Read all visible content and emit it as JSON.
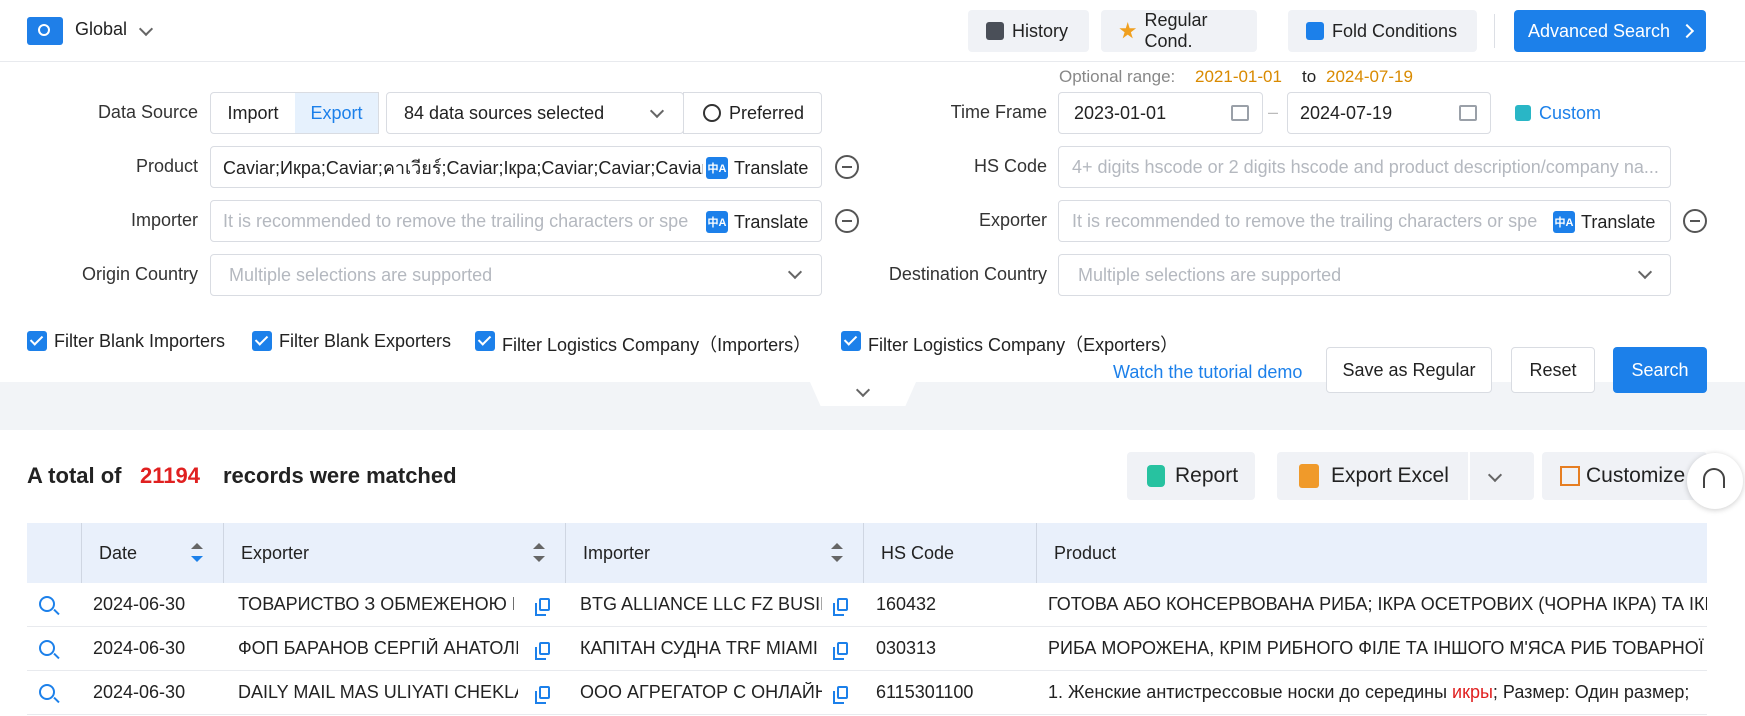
{
  "header": {
    "scope_label": "Global",
    "history": "History",
    "regular_cond": "Regular Cond.",
    "fold_conditions": "Fold Conditions",
    "advanced_search": "Advanced Search"
  },
  "form": {
    "optional_range_label": "Optional range:",
    "range_from": "2021-01-01",
    "range_to_word": "to",
    "range_to": "2024-07-19",
    "data_source_label": "Data Source",
    "import": "Import",
    "export": "Export",
    "sources_selected": "84 data sources selected",
    "preferred": "Preferred",
    "time_frame_label": "Time Frame",
    "date_from": "2023-01-01",
    "date_to": "2024-07-19",
    "custom": "Custom",
    "product_label": "Product",
    "product_value": "Caviar;Икра;Caviar;คาเวียร์;Caviar;Ікра;Caviar;Caviar;Caviar",
    "translate": "Translate",
    "hs_code_label": "HS Code",
    "hs_code_placeholder": "4+ digits hscode or 2 digits hscode and product description/company na...",
    "importer_label": "Importer",
    "importer_placeholder": "It is recommended to remove the trailing characters or spe",
    "exporter_label": "Exporter",
    "exporter_placeholder": "It is recommended to remove the trailing characters or spe",
    "origin_label": "Origin Country",
    "origin_placeholder": "Multiple selections are supported",
    "destination_label": "Destination Country",
    "destination_placeholder": "Multiple selections are supported",
    "filters": [
      "Filter Blank Importers",
      "Filter Blank Exporters",
      "Filter Logistics Company（Importers）",
      "Filter Logistics Company（Exporters）"
    ],
    "tutorial": "Watch the tutorial demo",
    "save_regular": "Save as Regular",
    "reset": "Reset",
    "search": "Search"
  },
  "results": {
    "prefix": "A total of",
    "count": "21194",
    "suffix": "records were matched",
    "report": "Report",
    "export_excel": "Export Excel",
    "customize": "Customize"
  },
  "table": {
    "headers": [
      "Date",
      "Exporter",
      "Importer",
      "HS Code",
      "Product"
    ],
    "rows": [
      {
        "date": "2024-06-30",
        "exporter": "ТОВАРИСТВО З ОБМЕЖЕНОЮ ВІ",
        "importer": "BTG ALLIANCE LLC FZ BUSIN",
        "hs": "160432",
        "product_a": "ГОТОВА АБО КОНСЕРВОВАНА РИБА; ІКРА ОСЕТРОВИХ (ЧОРНА ІКРА) ТА ІКРА ІН",
        "product_hl": "",
        "product_b": ""
      },
      {
        "date": "2024-06-30",
        "exporter": "ФОП БАРАНОВ СЕРГІЙ АНАТОЛІЙ",
        "importer": "КАПІТАН СУДНА TRF MIAMI",
        "hs": "030313",
        "product_a": "РИБА МОРОЖЕНА, КРІМ РИБНОГО ФІЛЕ ТА ІНШОГО М'ЯСА РИБ ТОВАРНОЇ ПОЗ",
        "product_hl": "",
        "product_b": ""
      },
      {
        "date": "2024-06-30",
        "exporter": "DAILY MAIL MAS ULIYATI CHEKLA",
        "importer": "ООО АГРЕГАТОР С ОНЛАЙН",
        "hs": "6115301100",
        "product_a": "1. Женские антистрессовые носки до середины ",
        "product_hl": "икры",
        "product_b": "; Размер: Один размер;"
      }
    ]
  }
}
